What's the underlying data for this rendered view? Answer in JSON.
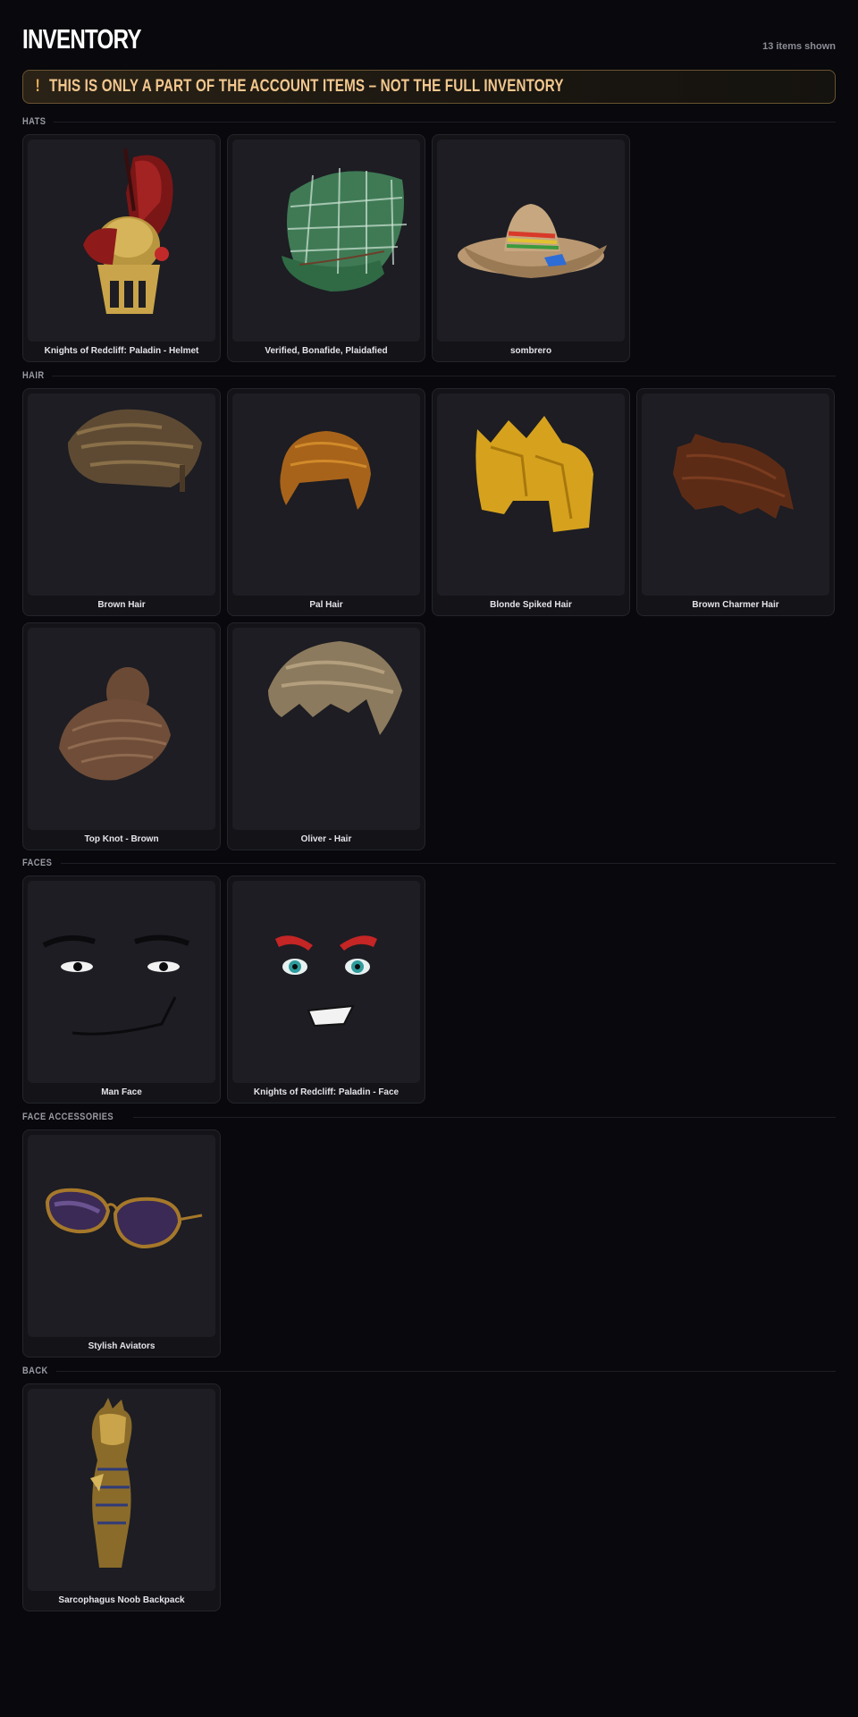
{
  "header": {
    "title": "INVENTORY",
    "count": "13 items shown"
  },
  "notice": {
    "icon": "!",
    "text": "THIS IS ONLY A PART OF THE ACCOUNT ITEMS – NOT THE FULL INVENTORY",
    "accent": "#f2c78e"
  },
  "sections": [
    {
      "label": "HATS",
      "items": [
        {
          "name": "Knights of Redcliff: Paladin - Helmet",
          "icon": "paladin-helmet"
        },
        {
          "name": "Verified, Bonafide, Plaidafied",
          "icon": "plaid-cap"
        },
        {
          "name": "sombrero",
          "icon": "sombrero"
        }
      ]
    },
    {
      "label": "HAIR",
      "items": [
        {
          "name": "Brown Hair",
          "icon": "brown-hair"
        },
        {
          "name": "Pal Hair",
          "icon": "pal-hair"
        },
        {
          "name": "Blonde Spiked Hair",
          "icon": "blonde-spiked-hair"
        },
        {
          "name": "Brown Charmer Hair",
          "icon": "brown-charmer-hair"
        },
        {
          "name": "Top Knot - Brown",
          "icon": "top-knot"
        },
        {
          "name": "Oliver - Hair",
          "icon": "oliver-hair"
        }
      ]
    },
    {
      "label": "FACES",
      "items": [
        {
          "name": "Man Face",
          "icon": "man-face"
        },
        {
          "name": "Knights of Redcliff: Paladin - Face",
          "icon": "paladin-face"
        }
      ]
    },
    {
      "label": "FACE ACCESSORIES",
      "items": [
        {
          "name": "Stylish Aviators",
          "icon": "aviators"
        }
      ]
    },
    {
      "label": "BACK",
      "items": [
        {
          "name": "Sarcophagus Noob Backpack",
          "icon": "sarcophagus"
        }
      ]
    }
  ]
}
